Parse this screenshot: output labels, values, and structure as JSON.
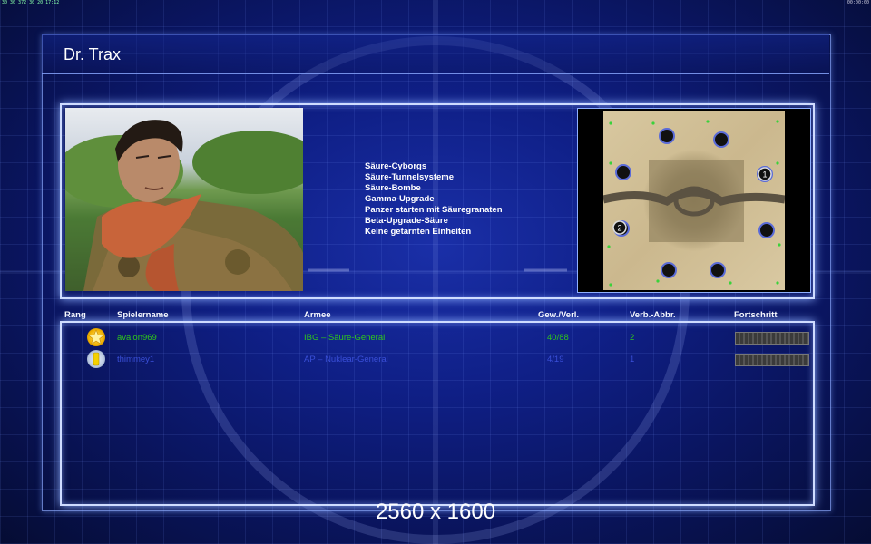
{
  "status_bar": {
    "left": "30 30 372 30 20:17:12",
    "right": "00:00:00"
  },
  "screen_title": "Dr. Trax",
  "perks": [
    "Säure-Cyborgs",
    "Säure-Tunnelsysteme",
    "Säure-Bombe",
    "Gamma-Upgrade",
    "Panzer starten mit Säuregranaten",
    "Beta-Upgrade-Säure",
    "Keine getarnten Einheiten"
  ],
  "map": {
    "start_labels": [
      "1",
      "2"
    ]
  },
  "table": {
    "headers": {
      "rank": "Rang",
      "name": "Spielername",
      "army": "Armee",
      "winloss": "Gew./Verl.",
      "disconnects": "Verb.-Abbr.",
      "progress": "Fortschritt"
    },
    "rows": [
      {
        "rank_icon": "gold-star-rank-icon",
        "name": "avalon969",
        "army": "IBG – Säure-General",
        "winloss": "40/88",
        "disconnects": "2",
        "color": "#2fc81a"
      },
      {
        "rank_icon": "yellow-bar-rank-icon",
        "name": "thimmey1",
        "army": "AP – Nuklear-General",
        "winloss": "4/19",
        "disconnects": "1",
        "color": "#3a4fd8"
      }
    ]
  },
  "watermark": "2560 x 1600"
}
